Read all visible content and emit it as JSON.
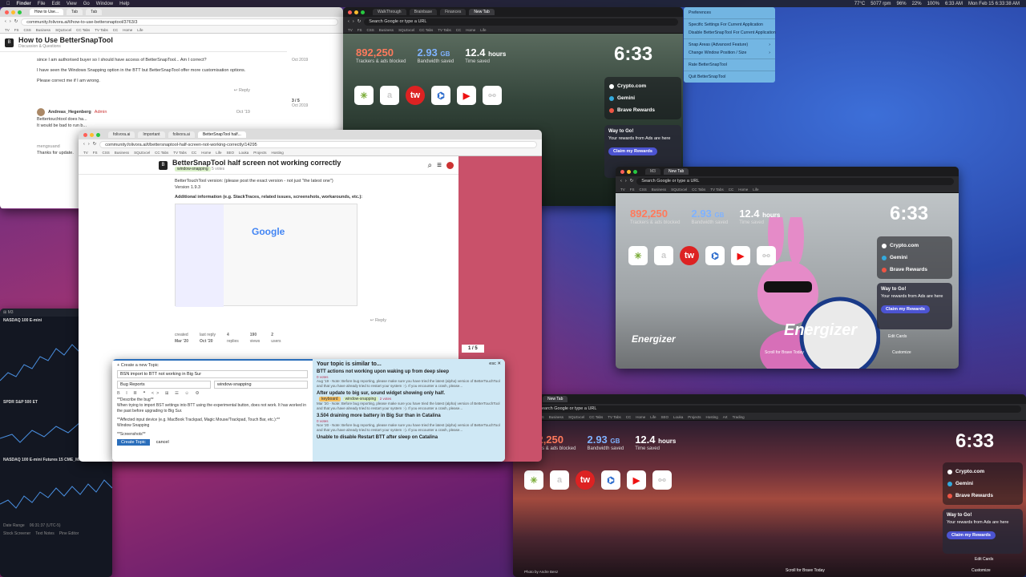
{
  "menubar": {
    "app": "Finder",
    "items": [
      "File",
      "Edit",
      "View",
      "Go",
      "Window",
      "Help"
    ],
    "status": [
      "77°C",
      "5077 rpm",
      "96%",
      "22%",
      "100%"
    ],
    "time": "6:33 AM",
    "datetime": "Mon Feb 15 6:33:38 AM"
  },
  "ctx_menu": {
    "items": [
      "Preferences",
      "Specific Settings For Current Application",
      "Disable BetterSnapTool For Current Application",
      "Snap Areas (Advanced Feature)",
      "Change Window Position / Size",
      "Rate BetterSnapTool",
      "Quit BetterSnapTool"
    ]
  },
  "bookmarks": [
    "TV",
    "FS",
    "CSS",
    "Business",
    "SQLExcel",
    "CC Tabs",
    "TV Tabs",
    "CC",
    "Home",
    "Life",
    "SEO",
    "Louka",
    "Projects",
    "Hosting",
    "Art",
    "Trading"
  ],
  "brave": {
    "trackers": "892,250",
    "trackers_label": "Trackers & ads blocked",
    "bandwidth_num": "2.93",
    "bandwidth_unit": "GB",
    "bandwidth_label": "Bandwidth saved",
    "time_num": "12.4",
    "time_unit": "hours",
    "time_label": "Time saved",
    "clock": "6:33",
    "search_placeholder": "Search Google or type a URL",
    "new_tab": "New Tab",
    "widget": [
      "Crypto.com",
      "Gemini",
      "Brave Rewards"
    ],
    "rewards_title": "Way to Go!",
    "rewards_text": "Your rewards from Ads are here",
    "rewards_button": "Claim my Rewards",
    "edit_cards": "Edit Cards",
    "customize": "Customize",
    "scroll_today": "Scroll for Brave Today",
    "photo_credit": "Photo by Andre Benz",
    "energizer": "Energizer"
  },
  "tiles": [
    "✳",
    "a",
    "tw",
    "⌬",
    "▶",
    "⚯"
  ],
  "win_top_left": {
    "url": "community.folivora.ai/t/how-to-use-bettersnaptool/3763/3",
    "title": "How to Use BetterSnapTool",
    "category": "Discussion & Questions",
    "p1": "since I am authorised buyer so I should have access of BetterSnapTool... Am I correct?",
    "p2": "I have seen the Windows Snapping option in the BTT but BetterSnapTool offer more customisation options.",
    "p3": "Please correct me if I am wrong.",
    "date1": "Oct 2019",
    "reply": "Reply",
    "counter": "3 / 5",
    "counter_date": "Oct 2019",
    "user": "Andreas_Hegenberg",
    "role": "Admin",
    "date2": "Oct '19",
    "p4": "Bettertouchtool does ha...",
    "p5": "It would be bad to run b...",
    "user2": "mengxuand",
    "p6": "Thanks for update."
  },
  "win_center": {
    "url": "community.folivora.ai/t/bettersnaptool-half-screen-not-working-correctly/14295",
    "title": "BetterSnapTool half screen not working correctly",
    "tag": "window-snapping",
    "votes": "5 votes",
    "bullet": "BetterTouchTool version: (please post the exact version - not just \"the latest one\")",
    "version": "Version 1.9.3",
    "additional": "Additional information (e.g. StackTraces, related issues, screenshots, workarounds, etc.):",
    "google": "Google",
    "reply": "Reply",
    "created_label": "created",
    "created": "Mar '20",
    "last_reply_label": "last reply",
    "last_reply": "Oct '20",
    "replies_num": "4",
    "replies_label": "replies",
    "views_num": "190",
    "views_label": "views",
    "users_num": "2",
    "users_label": "users",
    "pager": "1 / 5"
  },
  "composer": {
    "header": "Create a new Topic",
    "title_value": "BSN import to BTT not working in Big Sur",
    "category": "Bug Reports",
    "tag": "window-snapping",
    "body1": "**Describe the bug**",
    "body2": "When trying to import BST settings into BTT using the experimental button, does not work. It has worked in the past before upgrading to Big Sur.",
    "body3": "**Affected input device (e.g. MacBook Trackpad, Magic Mouse/Trackpad, Touch Bar, etc.):**",
    "body4": "Window Snapping",
    "body5": "**Screenshots**",
    "create": "Create Topic",
    "cancel": "cancel"
  },
  "similar": {
    "header": "Your topic is similar to...",
    "esc": "esc",
    "items": [
      {
        "title": "BTT actions not working upon waking up from deep sleep",
        "votes": "0 votes",
        "snip": "Aug '19 - Note: Before bug reporting, please make sure you have tried the latest (alpha) version of BetterTouchTool and that you have already tried to restart your system :-). If you encounter a crash, please..."
      },
      {
        "title": "After update to big sur, sound widget showing only half.",
        "votes": "2 votes",
        "snip": "Mar '20 - Note: Before bug reporting, please make sure you have tried the latest (alpha) version of BetterTouchTool and that you have already tried to restart your system :-). If you encounter a crash, please..."
      },
      {
        "title": "3.504 draining more battery in Big Sur than in Catalina",
        "votes": "0 votes",
        "snip": "Nov '20 - Note: Before bug reporting, please make sure you have tried the latest (alpha) version of BetterTouchTool and that you have already tried to restart your system :-). If you encounter a crash, please..."
      },
      {
        "title": "Unable to disable Restart BTT after sleep on Catalina",
        "votes": "0 votes",
        "snip": "Dec '19 - Note: Before bug reporting..."
      }
    ],
    "tags": [
      "keyboard",
      "window-snapping"
    ]
  },
  "trading": {
    "sym1": "NASDAQ 100 E-mini",
    "sym2": "SPDR S&P 500 ET",
    "sym3": "NASDAQ 100 E-mini Futures  15  CME_MINI",
    "val": "13851.75",
    "bottom": [
      "Date Range",
      "Stock Screener",
      "Text Notes",
      "Pine Editor"
    ],
    "tz": "06:31:37 (UTC-5)"
  }
}
